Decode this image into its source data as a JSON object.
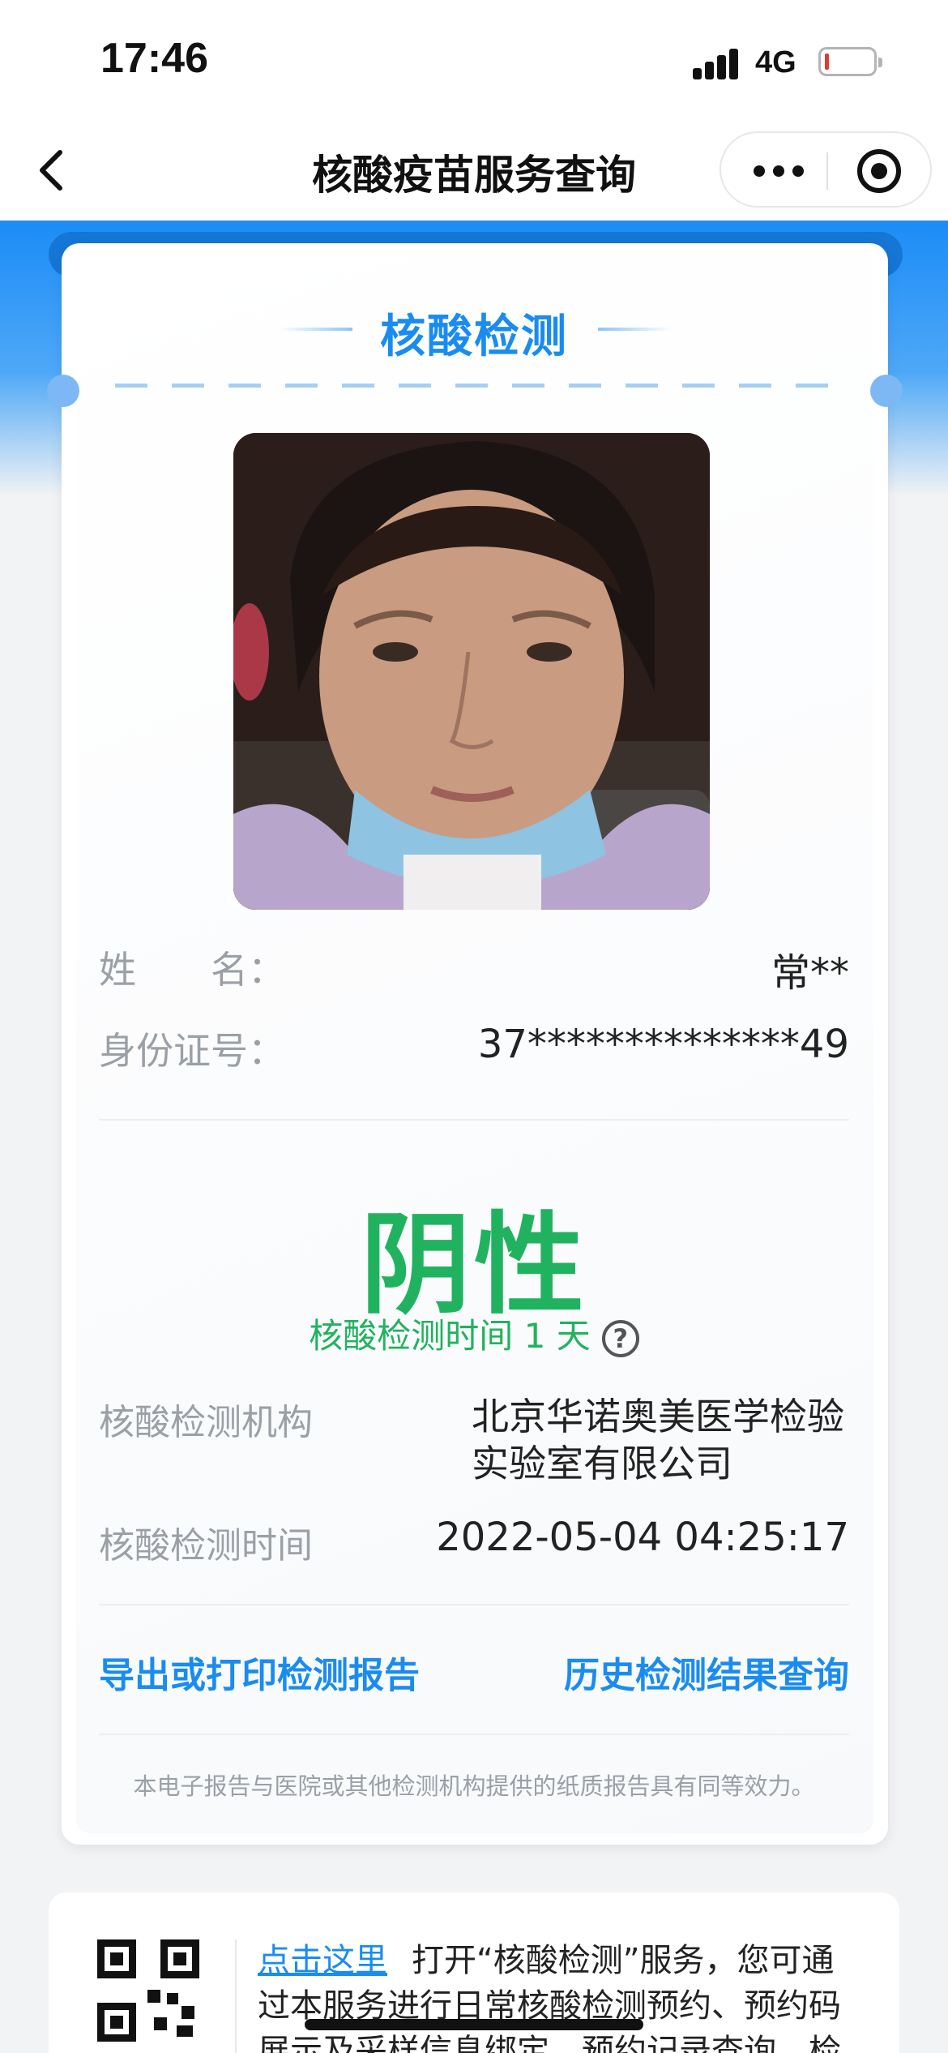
{
  "status_bar": {
    "time": "17:46",
    "network": "4G",
    "battery_level": 0.08,
    "battery_color": "#e03a2f"
  },
  "nav": {
    "title": "核酸疫苗服务查询",
    "back_icon": "chevron-left-icon",
    "more_icon": "more-dots-icon",
    "close_icon": "target-circle-icon"
  },
  "card": {
    "section_title": "核酸检测",
    "name_label": "姓　　名：",
    "name_value": "常**",
    "id_label": "身份证号：",
    "id_value": "37**************49",
    "result": "阴性",
    "result_color": "#21b25f",
    "test_age": "核酸检测时间 1 天",
    "help_icon": "question-circle-icon",
    "institution_label": "核酸检测机构",
    "institution_value": "北京华诺奥美医学检验实验室有限公司",
    "test_time_label": "核酸检测时间",
    "test_time_value": "2022-05-04 04:25:17",
    "export_link": "导出或打印检测报告",
    "history_link": "历史检测结果查询",
    "disclaimer": "本电子报告与医院或其他检测机构提供的纸质报告具有同等效力。"
  },
  "info": {
    "qr_icon": "qr-code-icon",
    "click_here": "点击这里",
    "text": "打开“核酸检测”服务，您可通过本服务进行日常核酸检测预约、预约码展示及采样信息绑定、预约记录查询、检测结果"
  },
  "colors": {
    "accent": "#1a8cf0",
    "header_gradient_top": "#1b8cf7"
  }
}
